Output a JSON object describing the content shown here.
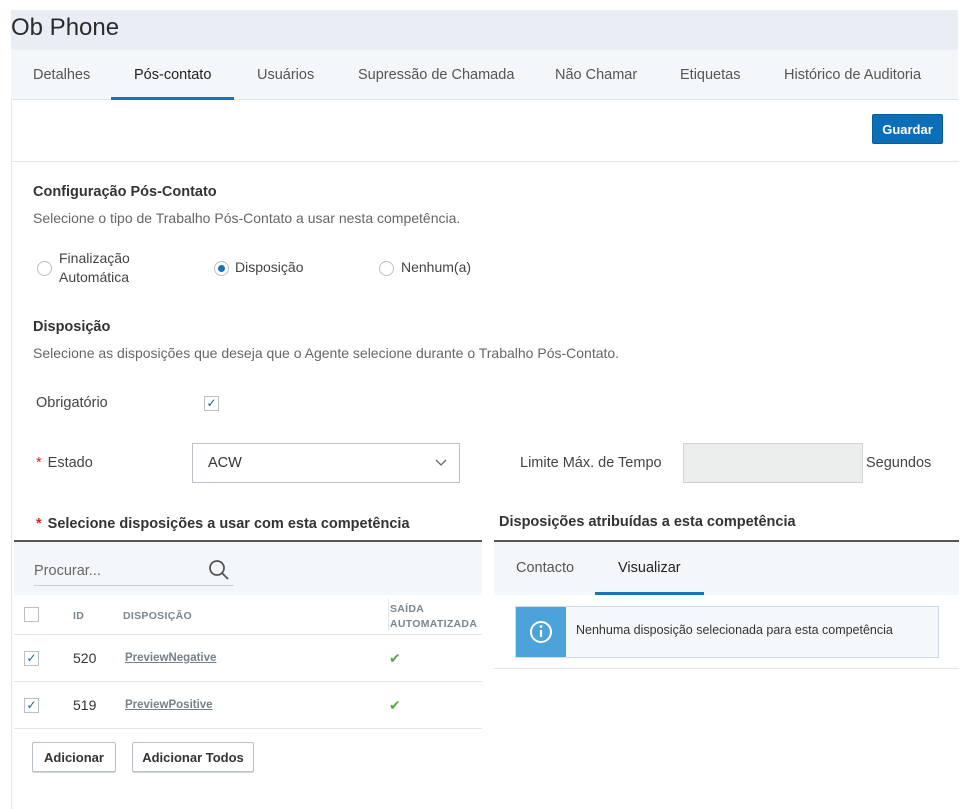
{
  "app": {
    "title": "Ob Phone"
  },
  "tabs": [
    {
      "label": "Detalhes",
      "active": false
    },
    {
      "label": "Pós-contato",
      "active": true
    },
    {
      "label": "Usuários",
      "active": false
    },
    {
      "label": "Supressão de Chamada",
      "active": false
    },
    {
      "label": "Não Chamar",
      "active": false
    },
    {
      "label": "Etiquetas",
      "active": false
    },
    {
      "label": "Histórico de Auditoria",
      "active": false
    }
  ],
  "toolbar": {
    "save_label": "Guardar"
  },
  "acw_config": {
    "title": "Configuração Pós-Contato",
    "description": "Selecione o tipo de Trabalho Pós-Contato a usar nesta competência.",
    "options": [
      {
        "label_line1": "Finalização",
        "label_line2": "Automática",
        "selected": false
      },
      {
        "label": "Disposição",
        "selected": true
      },
      {
        "label": "Nenhum(a)",
        "selected": false
      }
    ]
  },
  "disposition": {
    "title": "Disposição",
    "description": "Selecione as disposições que deseja que o Agente selecione durante o Trabalho Pós-Contato.",
    "required_label": "Obrigatório",
    "required_checked": true,
    "required_mark": "*",
    "state_label": "Estado",
    "state_value": "ACW",
    "max_time_label": "Limite Máx. de Tempo",
    "max_time_value": "",
    "seconds_label": "Segundos"
  },
  "select_dispositions": {
    "title": "Selecione disposições a usar com esta competência",
    "search_placeholder": "Procurar...",
    "columns": {
      "id": "ID",
      "disposition": "DISPOSIÇÃO",
      "auto_line1": "SAÍDA",
      "auto_line2": "AUTOMATIZADA"
    },
    "rows": [
      {
        "checked": true,
        "id": "520",
        "name": "PreviewNegative",
        "auto_exit": true
      },
      {
        "checked": true,
        "id": "519",
        "name": "PreviewPositive",
        "auto_exit": true
      }
    ],
    "add_label": "Adicionar",
    "add_all_label": "Adicionar Todos"
  },
  "assigned_dispositions": {
    "title": "Disposições atribuídas a esta competência",
    "tabs": [
      {
        "label": "Contacto",
        "active": false
      },
      {
        "label": "Visualizar",
        "active": true
      }
    ],
    "empty_message": "Nenhuma disposição selecionada para esta competência"
  },
  "colors": {
    "accent": "#1874b8",
    "primary_button": "#0a6fb8",
    "info": "#4ba3d9",
    "required": "#d0272a",
    "check": "#5aa844"
  }
}
